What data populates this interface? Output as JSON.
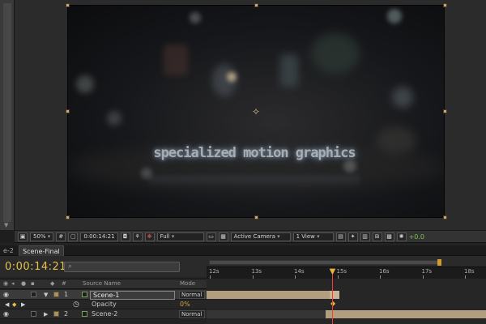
{
  "viewer": {
    "title_text": "specialized motion graphics",
    "toolbar": {
      "zoom": "50%",
      "timecode": "0:00:14:21",
      "resolution": "Full",
      "camera": "Active Camera",
      "views": "1 View",
      "exposure": "+0.0"
    }
  },
  "timeline": {
    "tabs": [
      "e-2",
      "Scene-Final"
    ],
    "current_time": "0:00:14:21",
    "search_placeholder": "",
    "columns": {
      "number": "#",
      "source_name": "Source Name",
      "mode": "Mode"
    },
    "ruler_labels": [
      "12s",
      "13s",
      "14s",
      "15s",
      "16s",
      "17s",
      "18s"
    ],
    "layers": [
      {
        "number": "1",
        "name": "Scene-1",
        "mode": "Normal",
        "selected": true
      },
      {
        "property": "Opacity",
        "value": "0%"
      },
      {
        "number": "2",
        "name": "Scene-2",
        "mode": "Normal",
        "selected": false
      }
    ]
  },
  "colors": {
    "timecode": "#e6c14a",
    "cti": "#ff3a2e",
    "layer_bar": "#b29e7e",
    "label_tan": "#a89063"
  },
  "icons": [
    "eye-icon",
    "audio-icon",
    "solo-icon",
    "lock-icon",
    "label-icon",
    "search-icon",
    "camera-icon",
    "color-icon",
    "grid-icon",
    "region-icon",
    "fast-preview-icon",
    "flowchart-icon",
    "keyframe-icon",
    "current-time-indicator-icon",
    "twirl-down-icon",
    "stopwatch-icon"
  ]
}
